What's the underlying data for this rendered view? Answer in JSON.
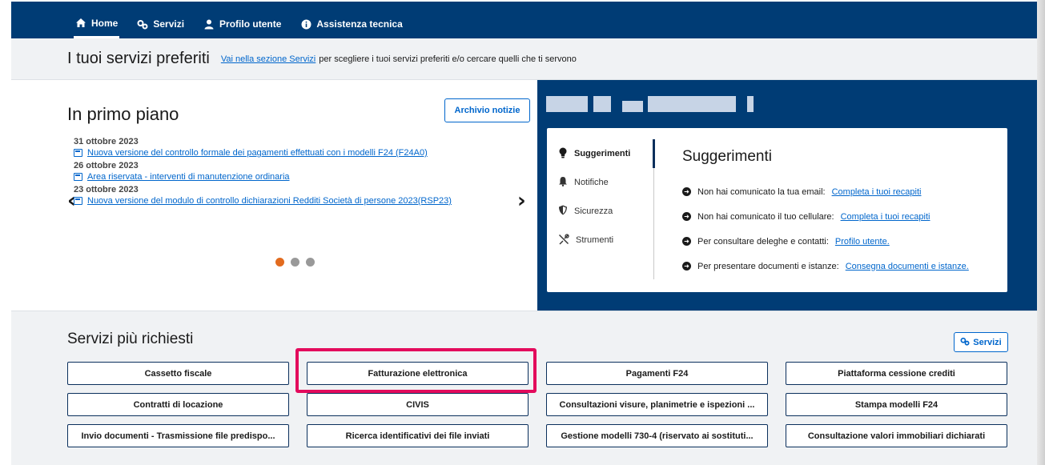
{
  "topnav": {
    "items": [
      {
        "label": "Home",
        "icon": "home-icon",
        "active": true
      },
      {
        "label": "Servizi",
        "icon": "services-icon"
      },
      {
        "label": "Profilo utente",
        "icon": "user-icon"
      },
      {
        "label": "Assistenza tecnica",
        "icon": "info-icon"
      }
    ]
  },
  "favorites": {
    "title": "I tuoi servizi preferiti",
    "link": "Vai nella sezione Servizi",
    "text": "per scegliere i tuoi servizi preferiti e/o cercare quelli che ti servono"
  },
  "primo_piano": {
    "title": "In primo piano",
    "archive_button": "Archivio notizie",
    "news": [
      {
        "date": "31 ottobre 2023",
        "title": "Nuova versione del controllo formale dei pagamenti effettuati con i modelli F24 (F24A0)"
      },
      {
        "date": "26 ottobre 2023",
        "title": "Area riservata - interventi di manutenzione ordinaria"
      },
      {
        "date": "23 ottobre 2023",
        "title": "Nuova versione del modulo di controllo dichiarazioni Redditi Società di persone 2023(RSP23)"
      }
    ],
    "prev": "‹",
    "next": "›"
  },
  "user_panel": {
    "nav": [
      {
        "label": "Suggerimenti",
        "icon": "lightbulb-icon",
        "active": true
      },
      {
        "label": "Notifiche",
        "icon": "bell-icon"
      },
      {
        "label": "Sicurezza",
        "icon": "shield-icon"
      },
      {
        "label": "Strumenti",
        "icon": "tools-icon"
      }
    ],
    "title": "Suggerimenti",
    "suggestions": [
      {
        "text": "Non hai comunicato la tua email:",
        "link": "Completa i tuoi recapiti"
      },
      {
        "text": "Non hai comunicato il tuo cellulare:",
        "link": "Completa i tuoi recapiti"
      },
      {
        "text": "Per consultare deleghe e contatti:",
        "link": "Profilo utente."
      },
      {
        "text": "Per presentare documenti e istanze:",
        "link": "Consegna documenti e istanze."
      }
    ]
  },
  "servizi": {
    "title": "Servizi più richiesti",
    "button": "Servizi",
    "items": [
      "Cassetto fiscale",
      "Fatturazione elettronica",
      "Pagamenti F24",
      "Piattaforma cessione crediti",
      "Contratti di locazione",
      "CIVIS",
      "Consultazioni visure, planimetrie e ispezioni ...",
      "Stampa modelli F24",
      "Invio documenti - Trasmissione file predispo...",
      "Ricerca identificativi dei file inviati",
      "Gestione modelli 730-4 (riservato ai sostituti...",
      "Consultazione valori immobiliari dichiarati"
    ]
  },
  "colors": {
    "navy": "#003c75",
    "link": "#0066cc",
    "highlight": "#e30b5c",
    "dot_active": "#e26b1f"
  }
}
